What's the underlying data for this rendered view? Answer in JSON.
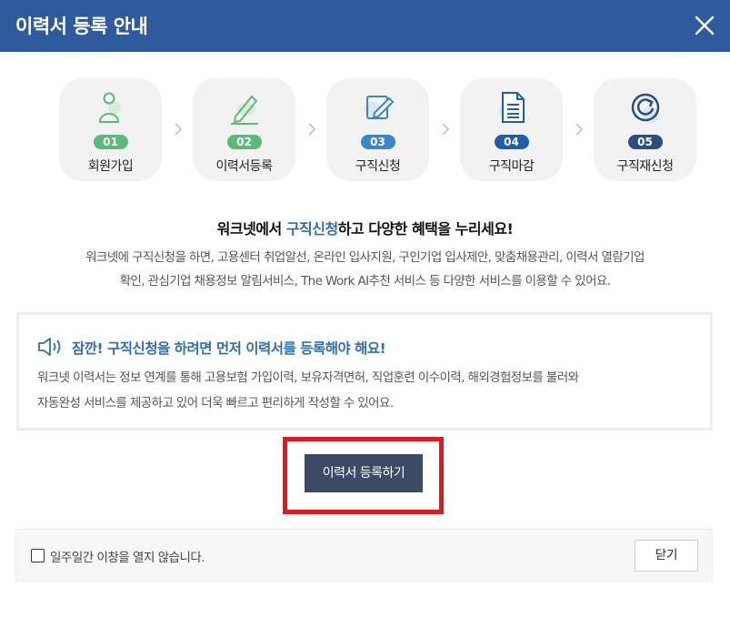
{
  "header": {
    "title": "이력서 등록 안내",
    "close_icon": "close-icon"
  },
  "steps": [
    {
      "number": "01",
      "label": "회원가입",
      "icon": "person-icon",
      "color": "#5db87a"
    },
    {
      "number": "02",
      "label": "이력서등록",
      "icon": "pencil-icon",
      "color": "#5db87a"
    },
    {
      "number": "03",
      "label": "구직신청",
      "icon": "edit-document-icon",
      "color": "#3a86c8"
    },
    {
      "number": "04",
      "label": "구직마감",
      "icon": "document-icon",
      "color": "#1f5ea8"
    },
    {
      "number": "05",
      "label": "구직재신청",
      "icon": "refresh-icon",
      "color": "#2c4e7e"
    }
  ],
  "headline": {
    "before": "워크넷에서 ",
    "highlight": "구직신청",
    "after": "하고 다양한 혜택을 누리세요!"
  },
  "description": {
    "line1": "워크넷에 구직신청을 하면, 고용센터 취업알선, 온라인 입사지원, 구인기업 입사제안, 맞춤채용관리, 이력서 열람기업",
    "line2": "확인, 관심기업 채용정보 알림서비스, The Work AI추천 서비스 등 다양한 서비스를 이용할 수 있어요."
  },
  "notice": {
    "icon": "speaker-icon",
    "title": "잠깐! 구직신청을 하려면 먼저 이력서를 등록해야 해요!",
    "line1": "워크넷 이력서는 정보 연계를 통해 고용보험 가입이력, 보유자격면허, 직업훈련 이수이력, 해외경험정보를 불러와",
    "line2": "자동완성 서비스를 제공하고 있어 더욱 빠르고 편리하게 작성할 수 있어요."
  },
  "register_button": "이력서 등록하기",
  "footer": {
    "checkbox_label": "일주일간 이창을 열지 않습니다.",
    "close_button": "닫기"
  },
  "colors": {
    "header": "#2f5b9c",
    "accent": "#2f6fb0",
    "button": "#3c4a66",
    "highlight": "#e4191f"
  }
}
